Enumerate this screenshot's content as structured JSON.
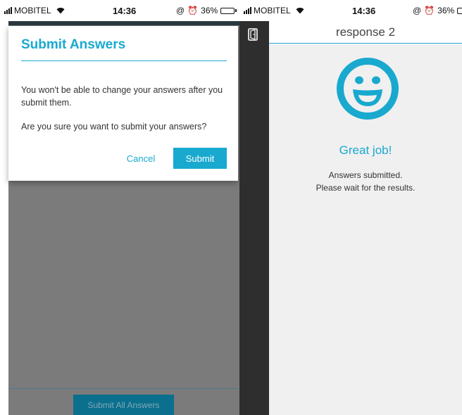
{
  "left": {
    "status": {
      "carrier": "MOBITEL",
      "time": "14:36",
      "battery": "36%",
      "battery_level": 0.36
    },
    "dialog": {
      "title": "Submit Answers",
      "message1": "You won't be able to change your answers after you submit them.",
      "message2": "Are you sure you want to submit your answers?",
      "cancel_label": "Cancel",
      "submit_label": "Submit"
    },
    "footer": {
      "submit_all_label": "Submit All Answers"
    }
  },
  "right": {
    "status": {
      "carrier": "MOBITEL",
      "time": "14:36",
      "battery": "36%",
      "battery_level": 0.36
    },
    "header": {
      "title": "response 2"
    },
    "result": {
      "heading": "Great job!",
      "line1": "Answers submitted.",
      "line2": "Please wait for the results."
    }
  },
  "icons": {
    "exit": "exit-door-icon",
    "smiley": "smiley-face-icon"
  },
  "colors": {
    "accent": "#19a9cf",
    "overlay": "#7b7b7b",
    "sidebar": "#2e2e2e",
    "background": "#f0f0f0"
  }
}
